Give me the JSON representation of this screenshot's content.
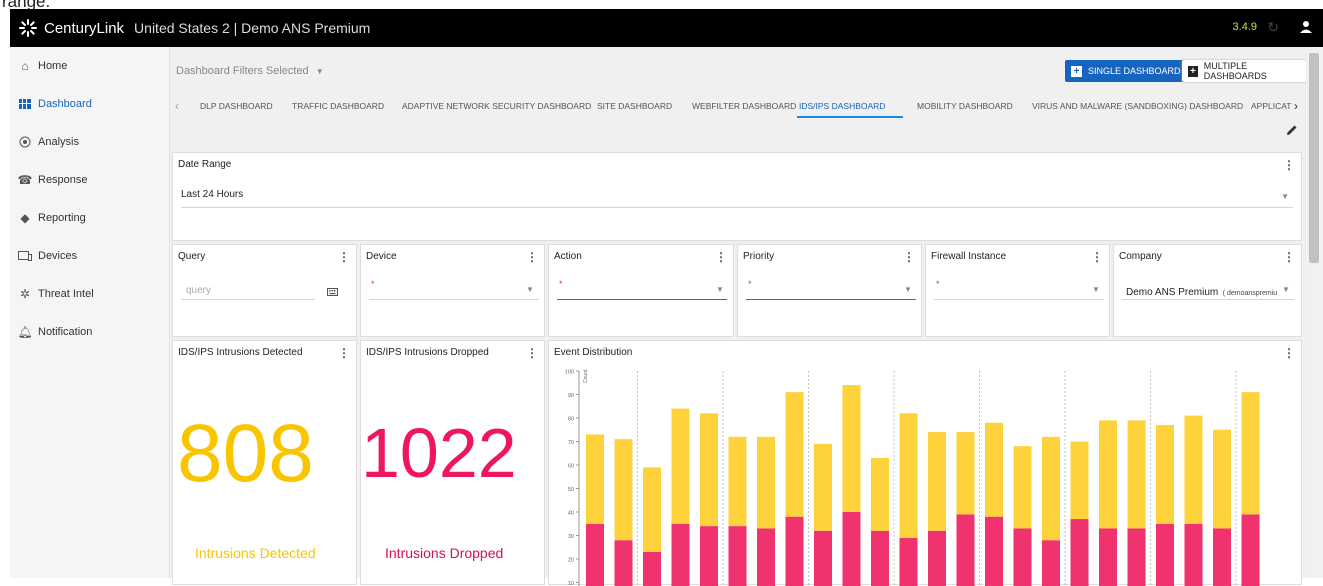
{
  "top_crop_text": "range.",
  "app": {
    "brand": "CenturyLink",
    "subtitle": "United States 2 | Demo ANS Premium",
    "version": "3.4.9"
  },
  "sidebar": {
    "items": [
      {
        "label": "Home",
        "icon": "home-icon"
      },
      {
        "label": "Dashboard",
        "icon": "dashboard-grid-icon",
        "active": true
      },
      {
        "label": "Analysis",
        "icon": "analysis-icon"
      },
      {
        "label": "Response",
        "icon": "response-icon"
      },
      {
        "label": "Reporting",
        "icon": "layers-icon"
      },
      {
        "label": "Devices",
        "icon": "devices-icon"
      },
      {
        "label": "Threat Intel",
        "icon": "threat-intel-icon"
      },
      {
        "label": "Notification",
        "icon": "bell-icon"
      }
    ]
  },
  "toolbar": {
    "filters_label": "Dashboard Filters Selected",
    "single_dashboard": "SINGLE DASHBOARD",
    "multiple_dashboards": "MULTIPLE DASHBOARDS"
  },
  "tabs": [
    "DLP DASHBOARD",
    "TRAFFIC DASHBOARD",
    "ADAPTIVE NETWORK SECURITY DASHBOARD",
    "SITE DASHBOARD",
    "WEBFILTER DASHBOARD",
    "IDS/IPS DASHBOARD",
    "MOBILITY DASHBOARD",
    "VIRUS AND MALWARE (SANDBOXING) DASHBOARD",
    "APPLICAT"
  ],
  "active_tab": "IDS/IPS DASHBOARD",
  "date_range": {
    "title": "Date Range",
    "value": "Last 24 Hours"
  },
  "filters": {
    "query": {
      "title": "Query",
      "placeholder": "query"
    },
    "device": {
      "title": "Device",
      "value": "*"
    },
    "action": {
      "title": "Action",
      "value": "*"
    },
    "priority": {
      "title": "Priority",
      "value": "*"
    },
    "firewall": {
      "title": "Firewall Instance",
      "value": "*"
    },
    "company": {
      "title": "Company",
      "value": "Demo ANS Premium",
      "value_sub": "( demoanspremiu"
    }
  },
  "kpis": {
    "detected": {
      "title": "IDS/IPS Intrusions Detected",
      "value": "808",
      "caption": "Intrusions Detected",
      "color": "#f9c400"
    },
    "dropped": {
      "title": "IDS/IPS Intrusions Dropped",
      "value": "1022",
      "caption": "Intrusions Dropped",
      "color": "#ee1660"
    }
  },
  "event_distribution": {
    "title": "Event Distribution"
  },
  "chart_data": {
    "type": "bar",
    "stacked": true,
    "ylabel": "Count",
    "ylim": [
      0,
      100
    ],
    "yticks": [
      10,
      20,
      30,
      40,
      50,
      60,
      70,
      80,
      90,
      100
    ],
    "series": [
      {
        "values": [
          35,
          28,
          23,
          35,
          34,
          34,
          33,
          38,
          32,
          40,
          32,
          29,
          32,
          39,
          38,
          33,
          28,
          37,
          33,
          33,
          35,
          35,
          33,
          39
        ],
        "color": "#f0326e"
      },
      {
        "values": [
          38,
          43,
          36,
          49,
          48,
          38,
          39,
          53,
          37,
          54,
          31,
          53,
          42,
          35,
          40,
          35,
          44,
          33,
          46,
          46,
          42,
          46,
          42,
          52
        ],
        "color": "#fdd23b"
      }
    ],
    "totals": [
      73,
      71,
      59,
      84,
      82,
      72,
      72,
      91,
      69,
      94,
      63,
      82,
      74,
      74,
      78,
      68,
      72,
      70,
      79,
      79,
      77,
      81,
      75,
      91
    ],
    "grid": false
  }
}
